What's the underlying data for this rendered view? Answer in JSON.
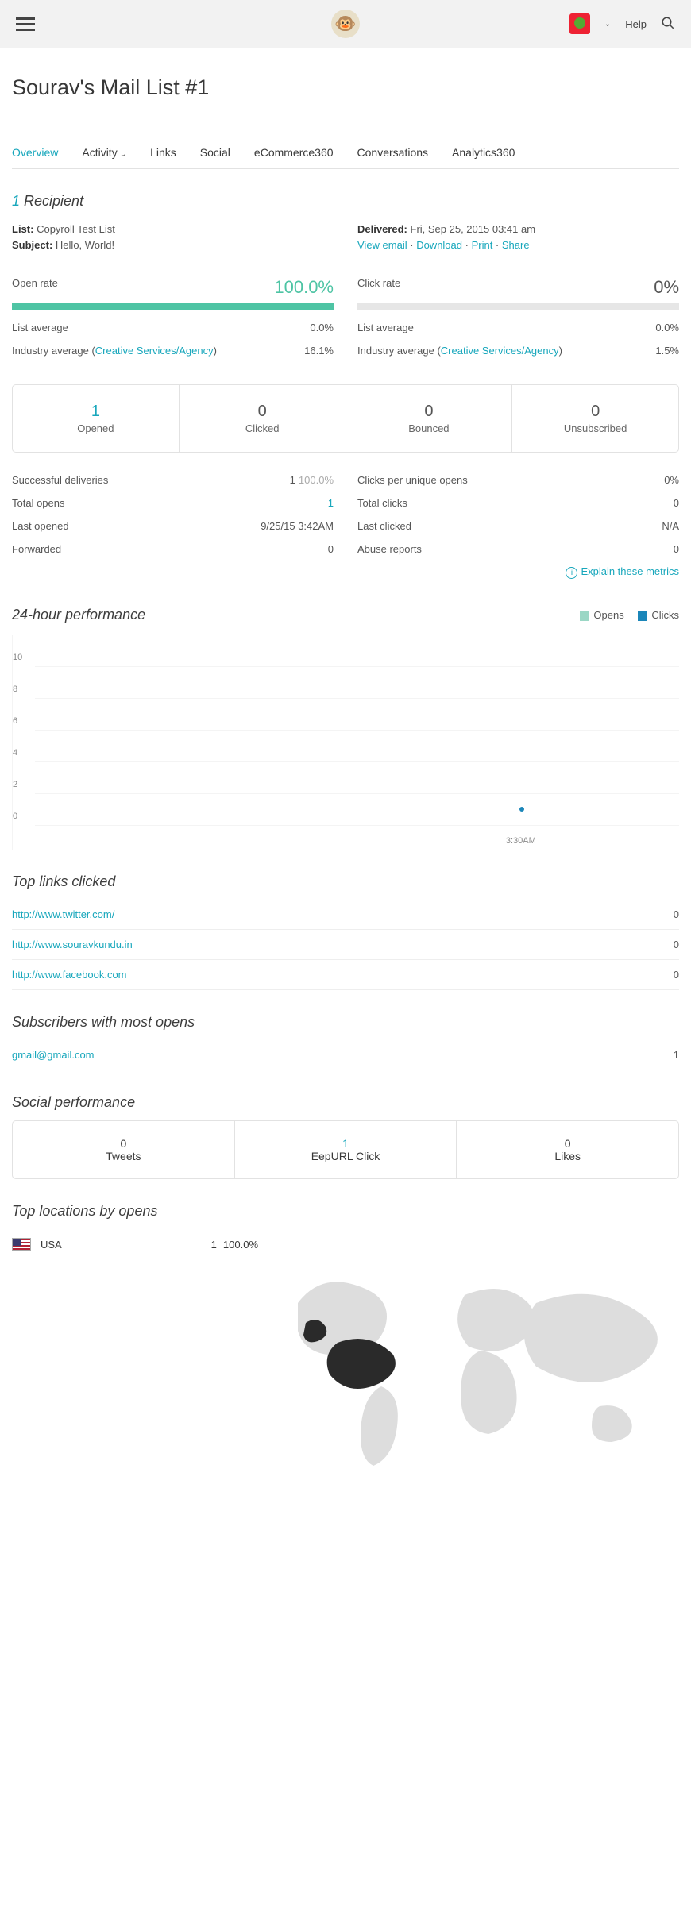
{
  "topbar": {
    "help_label": "Help"
  },
  "page_title": "Sourav's Mail List #1",
  "tabs": [
    "Overview",
    "Activity",
    "Links",
    "Social",
    "eCommerce360",
    "Conversations",
    "Analytics360"
  ],
  "recipient": {
    "count": "1",
    "word": "Recipient",
    "list_label": "List:",
    "list_value": "Copyroll Test List",
    "subject_label": "Subject:",
    "subject_value": "Hello, World!",
    "delivered_label": "Delivered:",
    "delivered_value": "Fri, Sep 25, 2015 03:41 am",
    "links": {
      "view": "View email",
      "download": "Download",
      "print": "Print",
      "share": "Share"
    }
  },
  "rates": {
    "open": {
      "label": "Open rate",
      "value": "100.0%",
      "fill_pct": 100,
      "list_avg_label": "List average",
      "list_avg_value": "0.0%",
      "ind_avg_label": "Industry average (",
      "ind_link": "Creative Services/Agency",
      "ind_close": ")",
      "ind_value": "16.1%"
    },
    "click": {
      "label": "Click rate",
      "value": "0%",
      "fill_pct": 0,
      "list_avg_label": "List average",
      "list_avg_value": "0.0%",
      "ind_avg_label": "Industry average (",
      "ind_link": "Creative Services/Agency",
      "ind_close": ")",
      "ind_value": "1.5%"
    }
  },
  "stat_cards": [
    {
      "n": "1",
      "l": "Opened",
      "link": true
    },
    {
      "n": "0",
      "l": "Clicked",
      "link": false
    },
    {
      "n": "0",
      "l": "Bounced",
      "link": false
    },
    {
      "n": "0",
      "l": "Unsubscribed",
      "link": false
    }
  ],
  "metrics_left": [
    {
      "k": "Successful deliveries",
      "v": "1",
      "extra": "100.0%"
    },
    {
      "k": "Total opens",
      "v": "1",
      "link": true
    },
    {
      "k": "Last opened",
      "v": "9/25/15 3:42AM"
    },
    {
      "k": "Forwarded",
      "v": "0"
    }
  ],
  "metrics_right": [
    {
      "k": "Clicks per unique opens",
      "v": "0%"
    },
    {
      "k": "Total clicks",
      "v": "0"
    },
    {
      "k": "Last clicked",
      "v": "N/A"
    },
    {
      "k": "Abuse reports",
      "v": "0"
    }
  ],
  "explain_label": "Explain these metrics",
  "perf": {
    "title": "24-hour performance",
    "legend_opens": "Opens",
    "legend_clicks": "Clicks"
  },
  "chart_data": {
    "type": "line",
    "ylim": [
      0,
      10
    ],
    "y_ticks": [
      0,
      2,
      4,
      6,
      8,
      10
    ],
    "x_label": "3:30AM",
    "series": [
      {
        "name": "Opens",
        "color": "#9bd7c5",
        "values": [
          1
        ]
      },
      {
        "name": "Clicks",
        "color": "#1b86b9",
        "values": [
          0
        ]
      }
    ]
  },
  "top_links": {
    "title": "Top links clicked",
    "rows": [
      {
        "url": "http://www.twitter.com/",
        "n": "0"
      },
      {
        "url": "http://www.souravkundu.in",
        "n": "0"
      },
      {
        "url": "http://www.facebook.com",
        "n": "0"
      }
    ]
  },
  "top_subs": {
    "title": "Subscribers with most opens",
    "rows": [
      {
        "email": "gmail@gmail.com",
        "n": "1"
      }
    ]
  },
  "social": {
    "title": "Social performance",
    "cards": [
      {
        "n": "0",
        "l": "Tweets",
        "link": false
      },
      {
        "n": "1",
        "l": "EepURL Click",
        "link": true
      },
      {
        "n": "0",
        "l": "Likes",
        "link": false
      }
    ]
  },
  "locations": {
    "title": "Top locations by opens",
    "rows": [
      {
        "country": "USA",
        "n": "1",
        "pct": "100.0%"
      }
    ]
  }
}
